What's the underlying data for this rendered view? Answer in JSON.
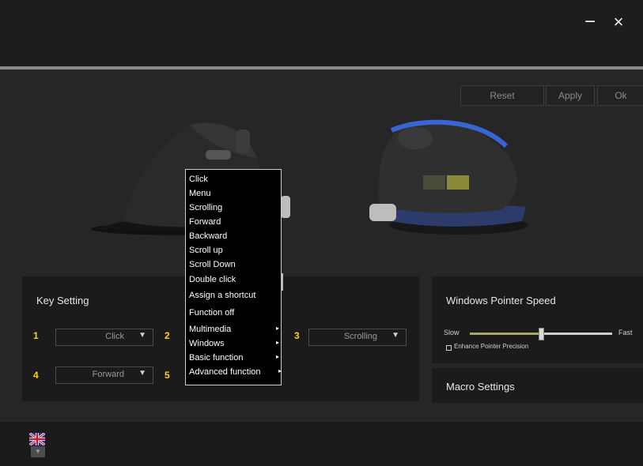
{
  "window": {
    "minimize_label": "−",
    "close_label": "×"
  },
  "toolbar": {
    "reset_label": "Reset",
    "apply_label": "Apply",
    "ok_label": "Ok"
  },
  "key_setting": {
    "title": "Key Setting",
    "slots": [
      {
        "num": "1",
        "value": "Click"
      },
      {
        "num": "2",
        "value": ""
      },
      {
        "num": "3",
        "value": "Scrolling"
      },
      {
        "num": "4",
        "value": "Forward"
      },
      {
        "num": "5",
        "value": ""
      }
    ],
    "dropdown_icon": "triangle-down-icon"
  },
  "context_menu": {
    "items": [
      {
        "label": "Click",
        "has_submenu": false
      },
      {
        "label": "Menu",
        "has_submenu": false
      },
      {
        "label": "Scrolling",
        "has_submenu": false
      },
      {
        "label": "Forward",
        "has_submenu": false
      },
      {
        "label": "Backward",
        "has_submenu": false
      },
      {
        "label": "Scroll up",
        "has_submenu": false
      },
      {
        "label": "Scroll Down",
        "has_submenu": false
      },
      {
        "label": "Double click",
        "has_submenu": false
      },
      {
        "label": "Assign a shortcut",
        "has_submenu": false
      },
      {
        "label": "Function off",
        "has_submenu": false
      },
      {
        "label": "Multimedia",
        "has_submenu": true
      },
      {
        "label": "Windows",
        "has_submenu": true
      },
      {
        "label": "Basic function",
        "has_submenu": true
      },
      {
        "label": "Advanced function",
        "has_submenu": true
      }
    ]
  },
  "pointer_speed": {
    "title": "Windows Pointer Speed",
    "slow_label": "Slow",
    "fast_label": "Fast",
    "value_fraction": 0.5,
    "enhance_label": "Enhance Pointer Precision",
    "enhance_checked": false
  },
  "macro": {
    "title": "Macro Settings"
  },
  "language": {
    "icon": "uk-flag-icon",
    "dropdown_icon": "triangle-down-icon"
  },
  "colors": {
    "accent_yellow": "#ffd21a",
    "slider_fill": "#a7a56a",
    "mouse_glow": "#3a6ee8"
  }
}
